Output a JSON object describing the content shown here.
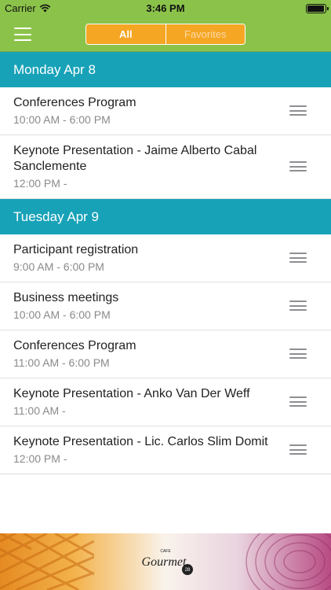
{
  "status_bar": {
    "carrier": "Carrier",
    "time": "3:46 PM"
  },
  "nav": {
    "tabs": [
      {
        "label": "All",
        "active": true
      },
      {
        "label": "Favorites",
        "active": false
      }
    ]
  },
  "schedule": {
    "days": [
      {
        "header": "Monday Apr 8",
        "events": [
          {
            "title": "Conferences Program",
            "time": "10:00 AM - 6:00 PM"
          },
          {
            "title": "Keynote Presentation - Jaime Alberto Cabal Sanclemente",
            "time": "12:00 PM -"
          }
        ]
      },
      {
        "header": "Tuesday Apr 9",
        "events": [
          {
            "title": "Participant registration",
            "time": "9:00 AM - 6:00 PM"
          },
          {
            "title": "Business meetings",
            "time": "10:00 AM - 6:00 PM"
          },
          {
            "title": "Conferences Program",
            "time": "11:00 AM - 6:00 PM"
          },
          {
            "title": "Keynote Presentation - Anko Van Der Weff",
            "time": "11:00 AM -"
          },
          {
            "title": "Keynote Presentation - Lic. Carlos Slim Domit",
            "time": "12:00 PM -"
          }
        ]
      }
    ]
  },
  "ad": {
    "logo_text": "Gourmet",
    "logo_top_text": "CAFE",
    "logo_badge": "28"
  },
  "colors": {
    "nav_green": "#8bc34a",
    "segment_orange": "#f5a623",
    "section_teal": "#17a2b8"
  }
}
